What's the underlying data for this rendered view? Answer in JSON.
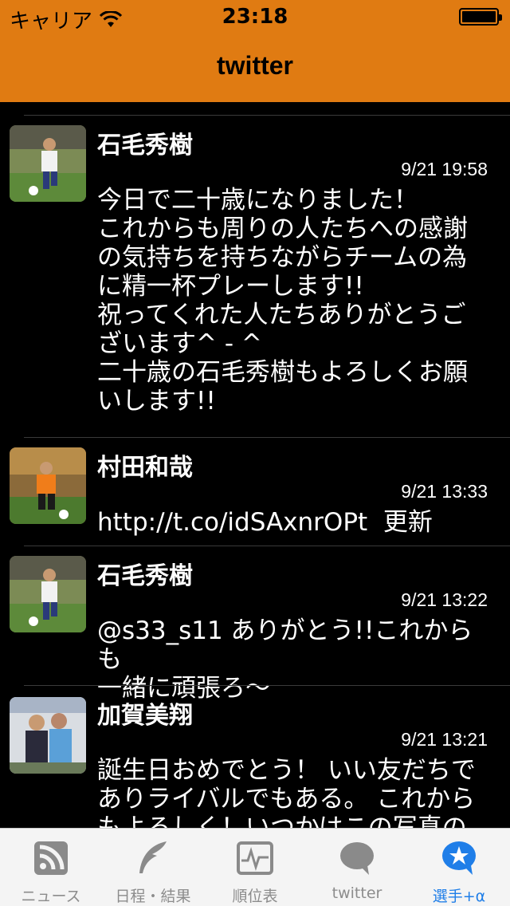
{
  "status_bar": {
    "carrier": "キャリア",
    "time": "23:18"
  },
  "nav": {
    "title": "twitter"
  },
  "tweets": [
    {
      "name": "石毛秀樹",
      "time": "9/21 19:58",
      "text": "今日で二十歳になりました！\nこれからも周りの人たちへの感謝\nの気持ちを持ちながらチームの為\nに精一杯プレーします!!\n祝ってくれた人たちありがとうご\nざいます^ - ^\n二十歳の石毛秀樹もよろしくお願\nいします!!"
    },
    {
      "name": "村田和哉",
      "time": "9/21 13:33",
      "text": "http://t.co/idSAxnrOPt  更新"
    },
    {
      "name": "石毛秀樹",
      "time": "9/21 13:22",
      "text": "@s33_s11 ありがとう!!これからも\n一緒に頑張ろ〜"
    },
    {
      "name": "加賀美翔",
      "time": "9/21 13:21",
      "text": "誕生日おめでとう！ いい友だちで\nありライバルでもある。 これから\nもよろしく！いつかはこの写真の"
    }
  ],
  "tabs": [
    {
      "label": "ニュース",
      "icon": "rss-icon"
    },
    {
      "label": "日程・結果",
      "icon": "feather-icon"
    },
    {
      "label": "順位表",
      "icon": "pulse-chart-icon"
    },
    {
      "label": "twitter",
      "icon": "speech-bubble-icon"
    },
    {
      "label": "選手+α",
      "icon": "star-bubble-icon",
      "active": true
    }
  ],
  "colors": {
    "nav_bar": "#e07b12",
    "active_tab": "#1f7ee8",
    "inactive_tab": "#8c8c8c"
  }
}
